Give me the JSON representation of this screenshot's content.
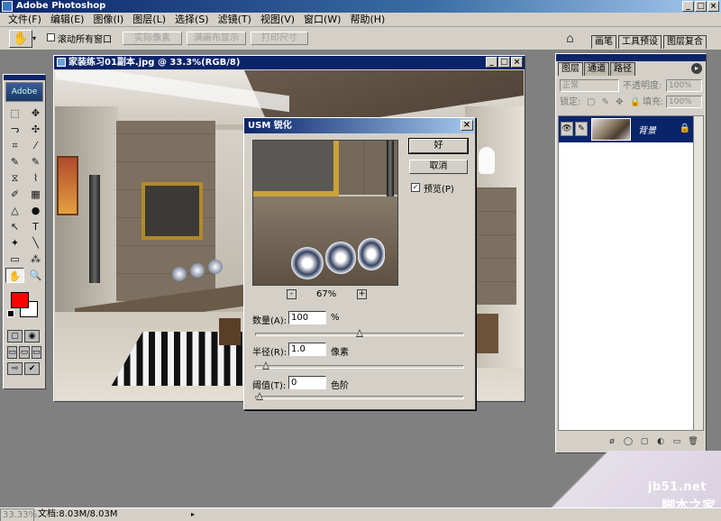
{
  "app": {
    "title": "Adobe Photoshop"
  },
  "window_buttons": {
    "minimize": "_",
    "maximize": "□",
    "close": "×"
  },
  "menu": [
    "文件(F)",
    "编辑(E)",
    "图像(I)",
    "图层(L)",
    "选择(S)",
    "滤镜(T)",
    "视图(V)",
    "窗口(W)",
    "帮助(H)"
  ],
  "options_bar": {
    "hand_icon": "✋",
    "arrow": "▾",
    "scroll_all_label": "滚动所有窗口",
    "actual_pixels": "实际像素",
    "fit_screen": "满画布显示",
    "print_size": "打印尺寸",
    "palette_tabs": [
      "画笔",
      "工具预设",
      "图层复合"
    ]
  },
  "document": {
    "title": "家装练习01副本.jpg @ 33.3%(RGB/8)",
    "buttons": {
      "minimize": "_",
      "maximize": "□",
      "close": "×"
    }
  },
  "toolbox": {
    "logo": "Adobe",
    "tools": [
      "⬚",
      "✥",
      "ᓓ",
      "✣",
      "⌗",
      "⁄",
      "✎",
      "✎",
      "⧖",
      "⌇",
      "✐",
      "▦",
      "△",
      "●",
      "↖",
      "T",
      "✦",
      "╲",
      "▭",
      "⁂",
      "✋",
      "🔍"
    ],
    "colors": {
      "foreground": "#ff0000",
      "background": "#ffffff"
    },
    "mode_row": [
      "▢",
      "◉"
    ],
    "screen_row": [
      "▭",
      "▭",
      "▭"
    ],
    "jump_row": [
      "⇨",
      "✔"
    ]
  },
  "layers_palette": {
    "tabs": [
      "图层",
      "通道",
      "路径"
    ],
    "menu_arrow": "▸",
    "blend_mode": "正常",
    "opacity_label": "不透明度:",
    "opacity_value": "100%",
    "lock_label": "锁定:",
    "fill_label": "填充:",
    "fill_value": "100%",
    "layer_name": "背景",
    "eye_icon": "👁",
    "brush_icon": "✎",
    "lock_icon": "🔒",
    "bottom_icons": [
      "ø",
      "◯",
      "▢",
      "◐",
      "▭",
      "🗑"
    ]
  },
  "usm_dialog": {
    "title": "USM 锐化",
    "close": "×",
    "ok": "好",
    "cancel": "取消",
    "preview_check": "✓",
    "preview_label": "预览(P)",
    "zoom_out": "-",
    "zoom_in": "+",
    "zoom": "67%",
    "amount": {
      "label": "数量(A):",
      "value": "100",
      "unit": "%",
      "slider": 0.5
    },
    "radius": {
      "label": "半径(R):",
      "value": "1.0",
      "unit": "像素",
      "slider": 0.03
    },
    "threshold": {
      "label": "阈值(T):",
      "value": "0",
      "unit": "色阶",
      "slider": 0.0
    }
  },
  "status_bar": {
    "zoom": "33.33%",
    "doc_size": "文档:8.03M/8.03M",
    "arrow": "▸"
  },
  "watermark": {
    "site": "jb51.net",
    "brand": "脚本之家"
  }
}
